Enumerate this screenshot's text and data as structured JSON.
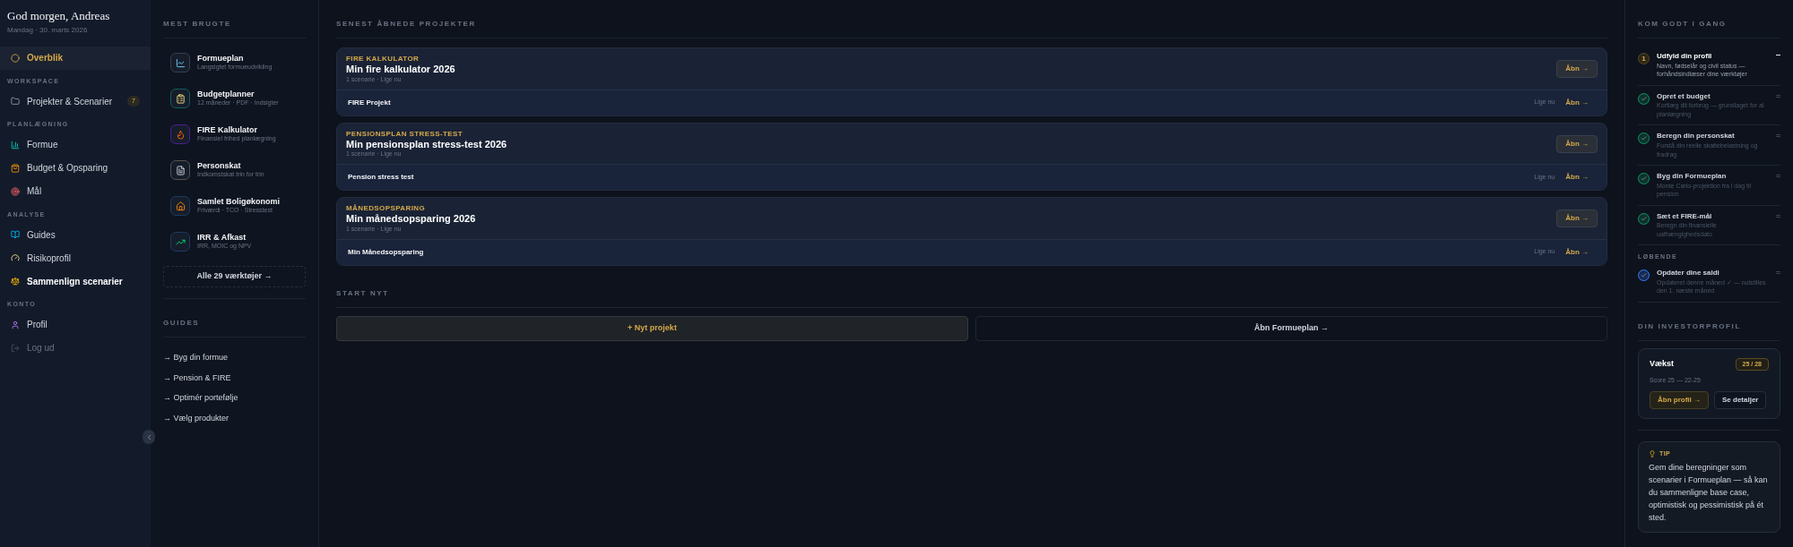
{
  "sidebar": {
    "greeting": "God morgen, Andreas",
    "date": "Mandag · 30. marts 2026",
    "sections": [
      {
        "items": [
          {
            "label": "Overblik",
            "selected": true
          }
        ]
      },
      {
        "title": "WORKSPACE",
        "items": [
          {
            "label": "Projekter & Scenarier",
            "selected": false,
            "badge": "7"
          }
        ]
      },
      {
        "title": "PLANLÆGNING",
        "items": [
          {
            "label": "Formue",
            "selected": false
          },
          {
            "label": "Budget & Opsparing",
            "selected": false
          },
          {
            "label": "Mål",
            "selected": false
          }
        ]
      },
      {
        "title": "ANALYSE",
        "items": [
          {
            "label": "Guides",
            "selected": false
          },
          {
            "label": "Risikoprofil",
            "selected": false
          },
          {
            "label": "Sammenlign scenarier",
            "selected": false,
            "bright": true
          }
        ]
      },
      {
        "title": "KONTO",
        "items": [
          {
            "label": "Profil",
            "selected": false
          },
          {
            "label": "Log ud",
            "selected": false,
            "muted": true
          }
        ]
      }
    ]
  },
  "tools": {
    "title": "MEST BRUGTE",
    "items": [
      {
        "name": "Formueplan",
        "subtitle": "Langsigtet formueudvikling"
      },
      {
        "name": "Budgetplanner",
        "subtitle": "12 måneder · PDF · Indsigter"
      },
      {
        "name": "FIRE Kalkulator",
        "subtitle": "Finansiel frihed planlægning"
      },
      {
        "name": "Personskat",
        "subtitle": "Indkomstskat trin for trin"
      },
      {
        "name": "Samlet Boligøkonomi",
        "subtitle": "Friværdi · TCO · Stresstest"
      },
      {
        "name": "IRR & Afkast",
        "subtitle": "IRR, MOIC og NPV"
      }
    ],
    "all_button": "Alle 29 værktøjer →",
    "guides_title": "GUIDES",
    "guides": [
      "→ Byg din formue",
      "→ Pension & FIRE",
      "→ Optimér portefølje",
      "→ Vælg produkter"
    ]
  },
  "recent": {
    "title": "SENEST ÅBNEDE PROJEKTER",
    "projects": [
      {
        "category": "FIRE KALKULATOR",
        "name": "Min fire kalkulator 2026",
        "meta": "1 scenarie · Lige nu",
        "open": "Åbn →",
        "scenario": "FIRE Projekt",
        "scenario_time": "Lige nu",
        "scenario_open": "Åbn →"
      },
      {
        "category": "PENSIONSPLAN STRESS-TEST",
        "name": "Min pensionsplan stress-test 2026",
        "meta": "1 scenarie · Lige nu",
        "open": "Åbn →",
        "scenario": "Pension stress test",
        "scenario_time": "Lige nu",
        "scenario_open": "Åbn →"
      },
      {
        "category": "MÅNEDSOPSPARING",
        "name": "Min månedsopsparing 2026",
        "meta": "1 scenarie · Lige nu",
        "open": "Åbn →",
        "scenario": "Min Månedsopsparing",
        "scenario_time": "Lige nu",
        "scenario_open": "Åbn →"
      }
    ]
  },
  "start": {
    "title": "START NYT",
    "primary": "+ Nyt projekt",
    "secondary": "Åbn Formueplan →"
  },
  "getting_started": {
    "title": "KOM GODT I GANG",
    "steps": [
      {
        "number": "1",
        "title": "Udfyld din profil",
        "text": "Navn, fødselår og civil status — forhåndsindlæser dine værktøjer",
        "done": false
      },
      {
        "title": "Opret et budget",
        "text": "Kortlæg dit forbrug — grundlaget for al planlægning",
        "done": true
      },
      {
        "title": "Beregn din personskat",
        "text": "Forstå din reelle skattebelastning og fradrag",
        "done": true
      },
      {
        "title": "Byg din Formueplan",
        "text": "Monte Carlo-projektion fra i dag til pension",
        "done": true
      },
      {
        "title": "Sæt et FIRE-mål",
        "text": "Beregn din finansielle uafhængighedsdato",
        "done": true
      }
    ],
    "ongoing_title": "LØBENDE",
    "ongoing": [
      {
        "title": "Opdater dine saldi",
        "text": "Opdateret denne måned ✓ — nulstilles den 1. næste måned",
        "done": true
      }
    ]
  },
  "investor": {
    "title": "DIN INVESTORPROFIL",
    "profile": "Vækst",
    "score_badge": "25 / 28",
    "score_text": "Score 25 — 22-25",
    "open": "Åbn profil →",
    "details": "Se detaljer"
  },
  "tip": {
    "label": "TIP",
    "text": "Gem dine beregninger som scenarier i Formueplan — så kan du sammenligne base case, optimistisk og pessimistisk på ét sted."
  }
}
